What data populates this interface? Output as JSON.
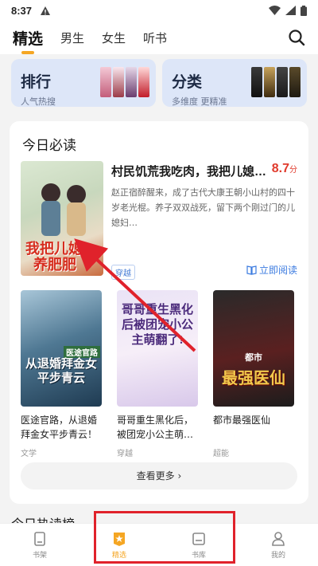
{
  "status_bar": {
    "time": "8:37"
  },
  "top_nav": {
    "tabs": [
      {
        "label": "精选",
        "active": true
      },
      {
        "label": "男生"
      },
      {
        "label": "女生"
      },
      {
        "label": "听书"
      }
    ]
  },
  "quick_links": [
    {
      "title": "排行",
      "subtitle": "人气热搜"
    },
    {
      "title": "分类",
      "subtitle": "多维度 更精准"
    }
  ],
  "section": {
    "title": "今日必读",
    "featured": {
      "title": "村民饥荒我吃肉，我把儿媳…",
      "score": "8.7",
      "score_unit": "分",
      "desc": "赵正宿醉醒来，成了古代大康王朝小山村的四十岁老光棍。养子双双战死，留下两个刚过门的儿媳妇…",
      "tag": "穿越",
      "read_label": "立即阅读",
      "cover_text_1": "我把儿媳",
      "cover_text_2": "养肥肥"
    },
    "books": [
      {
        "title": "医途官路，从退婚拜金女平步青云！",
        "category": "文学",
        "cover_text": "从退婚拜金女平步青云",
        "cover_label": "医途官路"
      },
      {
        "title": "哥哥重生黑化后，被团宠小公主萌…",
        "category": "穿越",
        "cover_text": "哥哥重生黑化后被团宠小公主萌翻了!"
      },
      {
        "title": "都市最强医仙",
        "category": "超能",
        "cover_text": "最强医仙",
        "cover_label": "都市"
      }
    ],
    "more_label": "查看更多"
  },
  "hot_title": "今日热读榜",
  "bottom_nav": [
    {
      "label": "书架"
    },
    {
      "label": "精选",
      "active": true
    },
    {
      "label": "书库"
    },
    {
      "label": "我的"
    }
  ],
  "colors": {
    "accent": "#f5a623",
    "highlight": "#e0222b",
    "link": "#3b7be0",
    "score": "#e03a2c"
  }
}
